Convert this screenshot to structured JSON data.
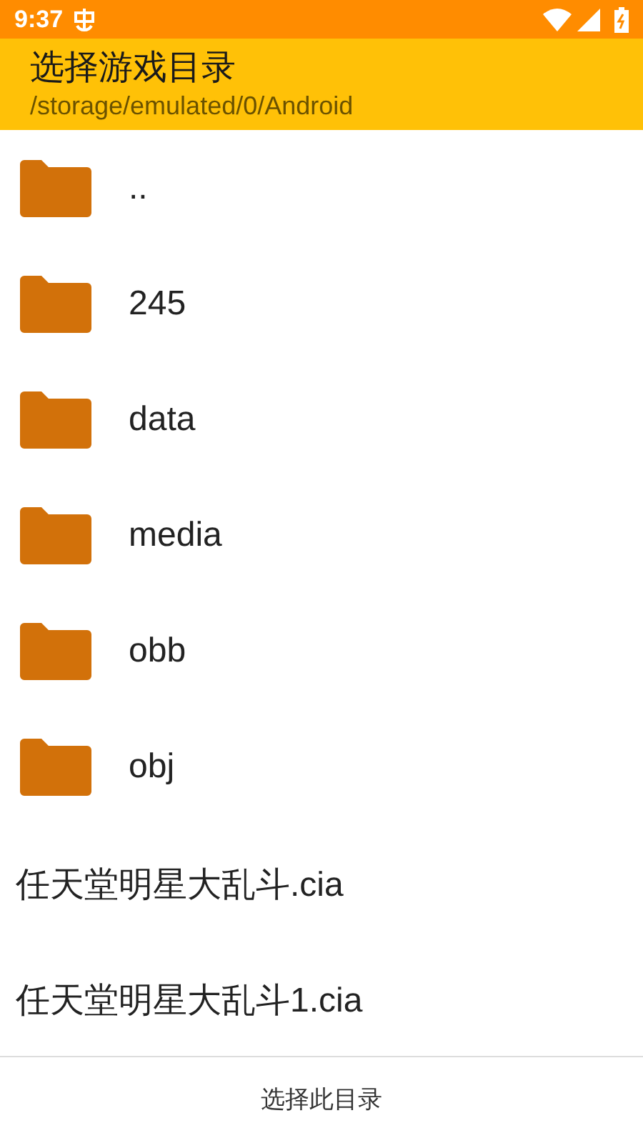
{
  "status_bar": {
    "time": "9:37"
  },
  "header": {
    "title": "选择游戏目录",
    "path": "/storage/emulated/0/Android"
  },
  "entries": [
    {
      "kind": "folder",
      "name": ".."
    },
    {
      "kind": "folder",
      "name": "245"
    },
    {
      "kind": "folder",
      "name": "data"
    },
    {
      "kind": "folder",
      "name": "media"
    },
    {
      "kind": "folder",
      "name": "obb"
    },
    {
      "kind": "folder",
      "name": "obj"
    },
    {
      "kind": "file",
      "name": "任天堂明星大乱斗.cia"
    },
    {
      "kind": "file",
      "name": "任天堂明星大乱斗1.cia"
    }
  ],
  "action_button": "选择此目录"
}
